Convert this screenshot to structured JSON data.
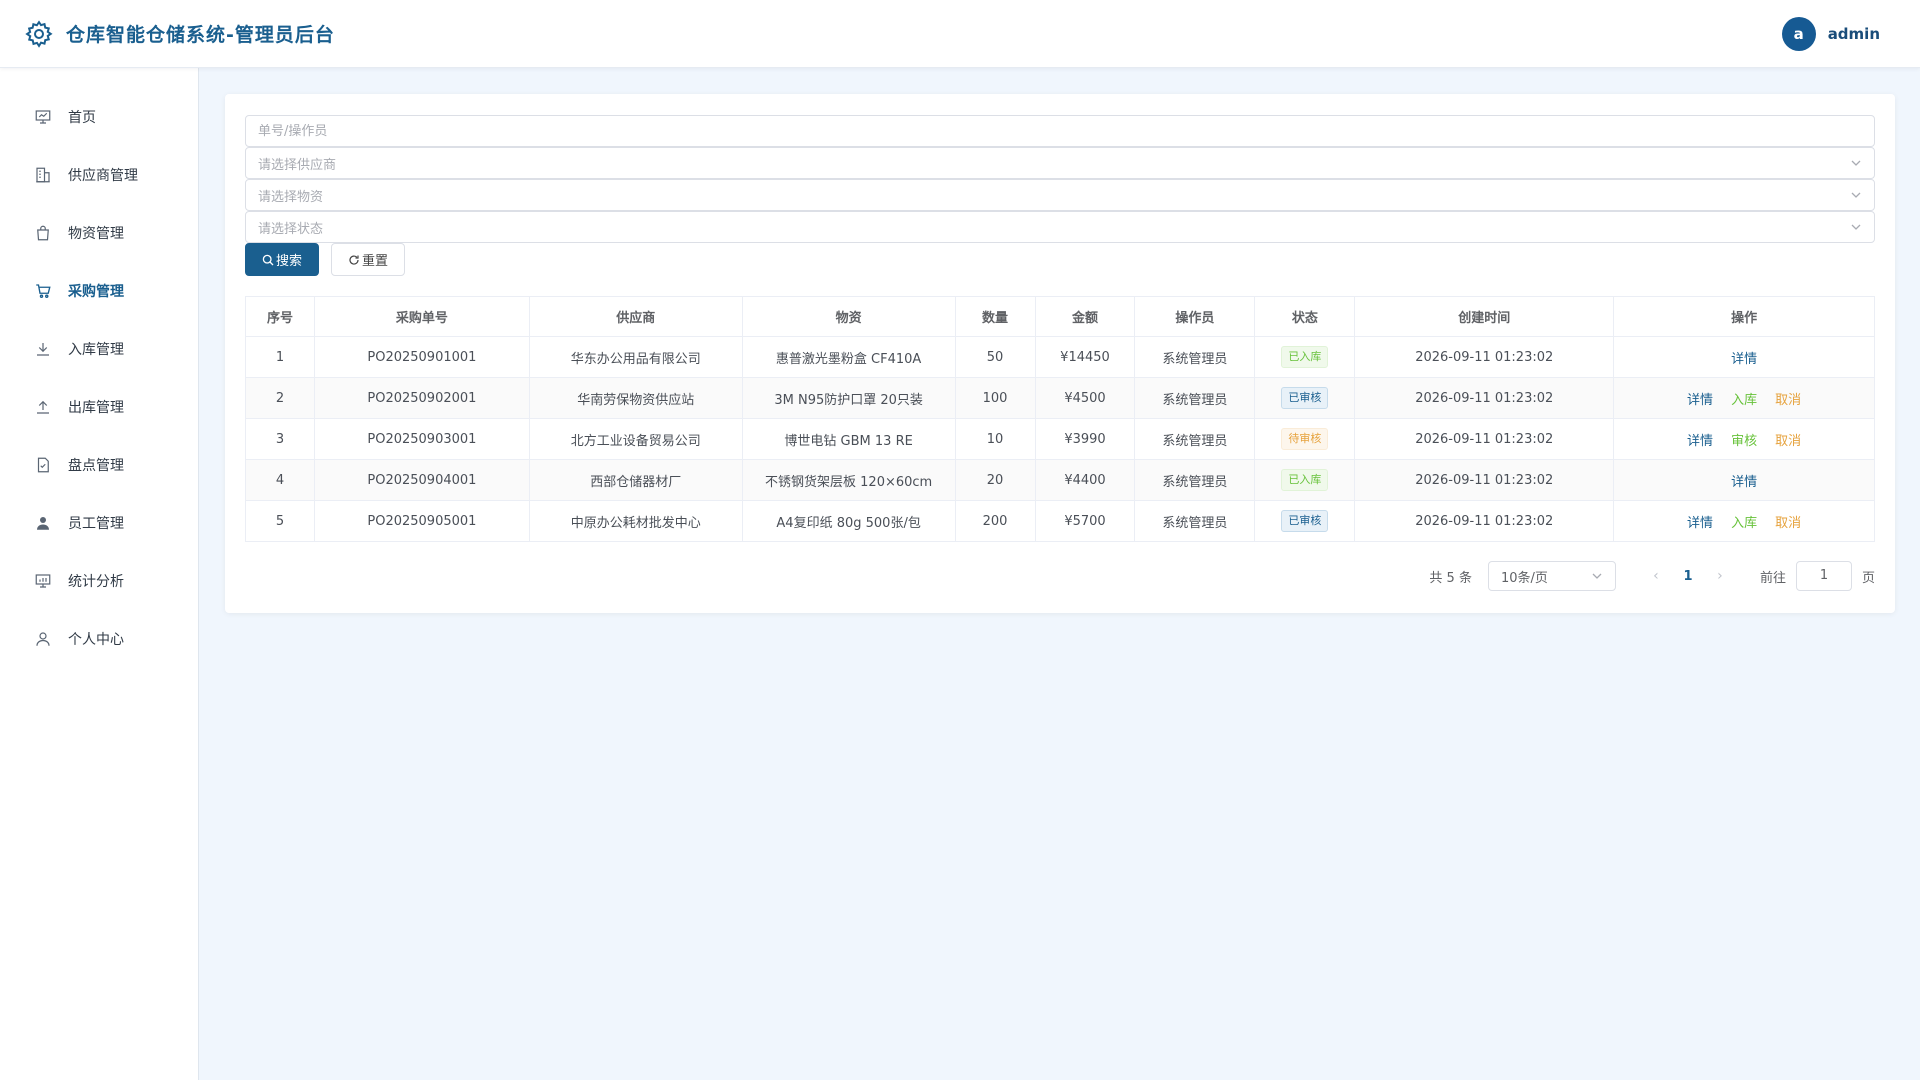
{
  "header": {
    "title": "仓库智能仓储系统-管理员后台",
    "avatar_letter": "a",
    "username": "admin"
  },
  "sidebar": {
    "items": [
      {
        "label": "首页",
        "icon": "presentation-icon",
        "active": false
      },
      {
        "label": "供应商管理",
        "icon": "building-icon",
        "active": false
      },
      {
        "label": "物资管理",
        "icon": "bag-icon",
        "active": false
      },
      {
        "label": "采购管理",
        "icon": "cart-icon",
        "active": true
      },
      {
        "label": "入库管理",
        "icon": "download-icon",
        "active": false
      },
      {
        "label": "出库管理",
        "icon": "upload-icon",
        "active": false
      },
      {
        "label": "盘点管理",
        "icon": "document-check-icon",
        "active": false
      },
      {
        "label": "员工管理",
        "icon": "user-filled-icon",
        "active": false
      },
      {
        "label": "统计分析",
        "icon": "chart-board-icon",
        "active": false
      },
      {
        "label": "个人中心",
        "icon": "user-icon",
        "active": false
      }
    ]
  },
  "filters": {
    "keyword_placeholder": "单号/操作员",
    "supplier_placeholder": "请选择供应商",
    "material_placeholder": "请选择物资",
    "status_placeholder": "请选择状态",
    "search_label": "搜索",
    "reset_label": "重置"
  },
  "table": {
    "columns": [
      "序号",
      "采购单号",
      "供应商",
      "物资",
      "数量",
      "金额",
      "操作员",
      "状态",
      "创建时间",
      "操作"
    ],
    "rows": [
      {
        "index": "1",
        "order_no": "PO20250901001",
        "supplier": "华东办公用品有限公司",
        "material": "惠普激光墨粉盒 CF410A",
        "qty": "50",
        "amount": "¥14450",
        "operator": "系统管理员",
        "status": "已入库",
        "status_type": "success",
        "created": "2026-09-11 01:23:02",
        "actions": [
          {
            "label": "详情",
            "type": "primary"
          }
        ]
      },
      {
        "index": "2",
        "order_no": "PO20250902001",
        "supplier": "华南劳保物资供应站",
        "material": "3M N95防护口罩 20只装",
        "qty": "100",
        "amount": "¥4500",
        "operator": "系统管理员",
        "status": "已审核",
        "status_type": "primary",
        "created": "2026-09-11 01:23:02",
        "actions": [
          {
            "label": "详情",
            "type": "primary"
          },
          {
            "label": "入库",
            "type": "success"
          },
          {
            "label": "取消",
            "type": "warning"
          }
        ]
      },
      {
        "index": "3",
        "order_no": "PO20250903001",
        "supplier": "北方工业设备贸易公司",
        "material": "博世电钻 GBM 13 RE",
        "qty": "10",
        "amount": "¥3990",
        "operator": "系统管理员",
        "status": "待审核",
        "status_type": "warning",
        "created": "2026-09-11 01:23:02",
        "actions": [
          {
            "label": "详情",
            "type": "primary"
          },
          {
            "label": "审核",
            "type": "success"
          },
          {
            "label": "取消",
            "type": "warning"
          }
        ]
      },
      {
        "index": "4",
        "order_no": "PO20250904001",
        "supplier": "西部仓储器材厂",
        "material": "不锈钢货架层板 120×60cm",
        "qty": "20",
        "amount": "¥4400",
        "operator": "系统管理员",
        "status": "已入库",
        "status_type": "success",
        "created": "2026-09-11 01:23:02",
        "actions": [
          {
            "label": "详情",
            "type": "primary"
          }
        ]
      },
      {
        "index": "5",
        "order_no": "PO20250905001",
        "supplier": "中原办公耗材批发中心",
        "material": "A4复印纸 80g 500张/包",
        "qty": "200",
        "amount": "¥5700",
        "operator": "系统管理员",
        "status": "已审核",
        "status_type": "primary",
        "created": "2026-09-11 01:23:02",
        "actions": [
          {
            "label": "详情",
            "type": "primary"
          },
          {
            "label": "入库",
            "type": "success"
          },
          {
            "label": "取消",
            "type": "warning"
          }
        ]
      }
    ]
  },
  "pagination": {
    "total_text": "共 5 条",
    "page_size": "10条/页",
    "current_page": "1",
    "goto_label": "前往",
    "goto_value": "1",
    "page_suffix": "页"
  },
  "colors": {
    "brand": "#1a5f8f",
    "success": "#67c23a",
    "primary": "#1a5f8f",
    "warning": "#e6a23c",
    "background": "#f0f6fd"
  }
}
